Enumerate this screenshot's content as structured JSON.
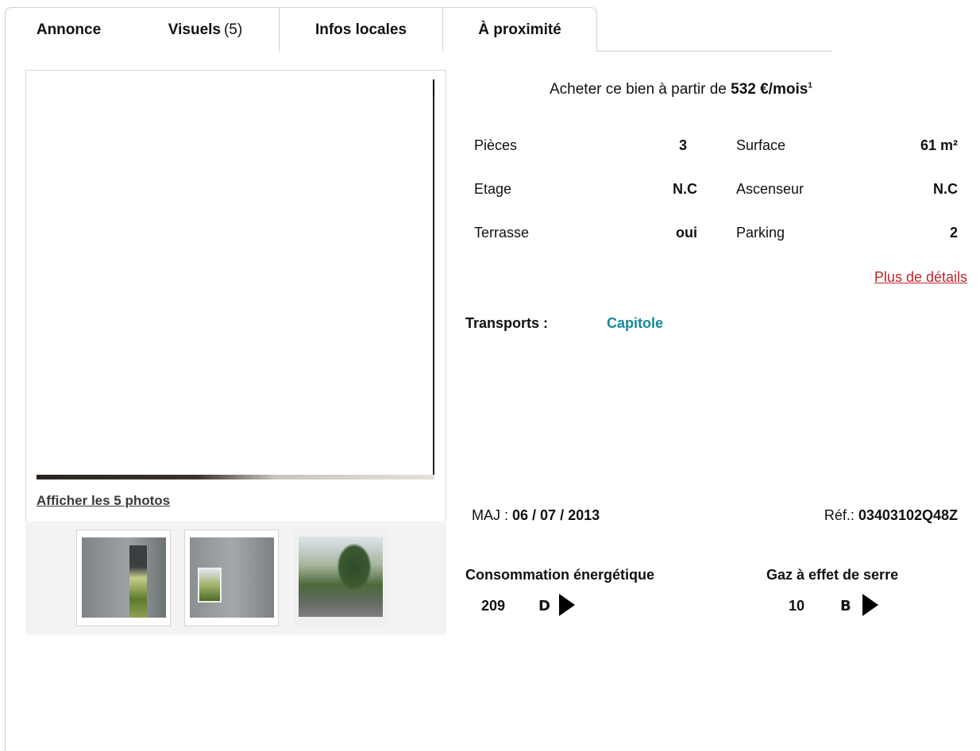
{
  "tabs": [
    {
      "label": "Annonce"
    },
    {
      "label": "Visuels",
      "count": "(5)"
    },
    {
      "label": "Infos locales"
    },
    {
      "label": "À proximité"
    }
  ],
  "photos": {
    "show_all_label": "Afficher les 5 photos"
  },
  "buy": {
    "prefix": "Acheter ce bien à partir de",
    "amount": "532 €/mois",
    "footnote": "1"
  },
  "specs": [
    {
      "label": "Pièces",
      "value": "3"
    },
    {
      "label": "Surface",
      "value": "61 m²"
    },
    {
      "label": "Etage",
      "value": "N.C"
    },
    {
      "label": "Ascenseur",
      "value": "N.C"
    },
    {
      "label": "Terrasse",
      "value": "oui"
    },
    {
      "label": "Parking",
      "value": "2"
    }
  ],
  "more_details": "Plus de détails",
  "transports": {
    "label": "Transports :",
    "value": "Capitole"
  },
  "updated": {
    "label": "MAJ : ",
    "value": "06 / 07 / 2013"
  },
  "reference": {
    "label": "Réf.: ",
    "value": "03403102Q48Z"
  },
  "energy": {
    "title": "Consommation énergétique",
    "value": "209",
    "class": "D"
  },
  "gas": {
    "title": "Gaz à effet de serre",
    "value": "10",
    "class": "B"
  },
  "icons": [
    "energy-arrow-icon",
    "gas-arrow-icon"
  ]
}
